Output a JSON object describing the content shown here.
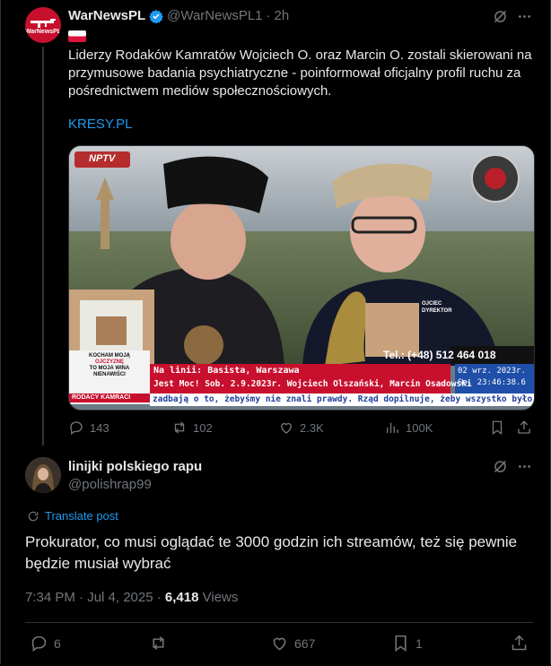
{
  "quoted_post": {
    "display_name": "WarNewsPL",
    "handle": "@WarNewsPL1",
    "separator": "·",
    "time": "2h",
    "avatar_text": "WarNewsPL",
    "text": "Liderzy Rodaków Kamratów Wojciech O. oraz Marcin O.  zostali skierowani na przymusowe badania psychiatryczne - poinformował  oficjalny profil ruchu za pośrednictwem mediów społecznościowych.",
    "link_text": "KRESY.PL",
    "media": {
      "channel_logo": "NPTV",
      "banner_left_1": "KOCHAM MOJĄ",
      "banner_left_2": "OJCZYZNĘ",
      "banner_left_3": "TO MOJA WINA",
      "banner_left_4": "NIENAWIŚCI",
      "banner_left_5": "RODACY KAMRACI",
      "line_1": "Na linii: Basista, Warszawa",
      "line_2": "Jest Moc! Sob. 2.9.2023r. Wojciech Olszański, Marcin Osadowski",
      "phone": "Tel.: (+48) 512 464 018",
      "date": "02 wrz. 2023r.",
      "clock": "So. 23:46:38.6",
      "ticker": "zadbają o to, żebyśmy nie znali prawdy. Rząd dopilnuje, żeby wszystko było zrob",
      "sign_1": "OJCIEC",
      "sign_2": "DYREKTOR"
    },
    "stats": {
      "replies": "143",
      "reposts": "102",
      "likes": "2.3K",
      "views": "100K"
    }
  },
  "reply": {
    "display_name": "linijki polskiego rapu",
    "handle": "@polishrap99",
    "translate_label": "Translate post",
    "text": "Prokurator, co musi oglądać te 3000 godzin ich streamów, też się pewnie będzie musiał wybrać",
    "time": "7:34 PM · Jul 4, 2025 · ",
    "views_count": "6,418",
    "views_label": " Views",
    "stats": {
      "replies": "6",
      "likes": "667",
      "bookmarks": "1"
    }
  },
  "colors": {
    "background": "#000000",
    "text": "#e7e9ea",
    "muted": "#71767b",
    "accent": "#1d9bf0",
    "border": "#2f3336"
  },
  "icons": [
    "verified-icon",
    "grok-icon",
    "poland-flag-icon",
    "reply-icon",
    "repost-icon",
    "like-icon",
    "views-icon",
    "bookmark-icon",
    "share-icon",
    "translate-icon"
  ]
}
